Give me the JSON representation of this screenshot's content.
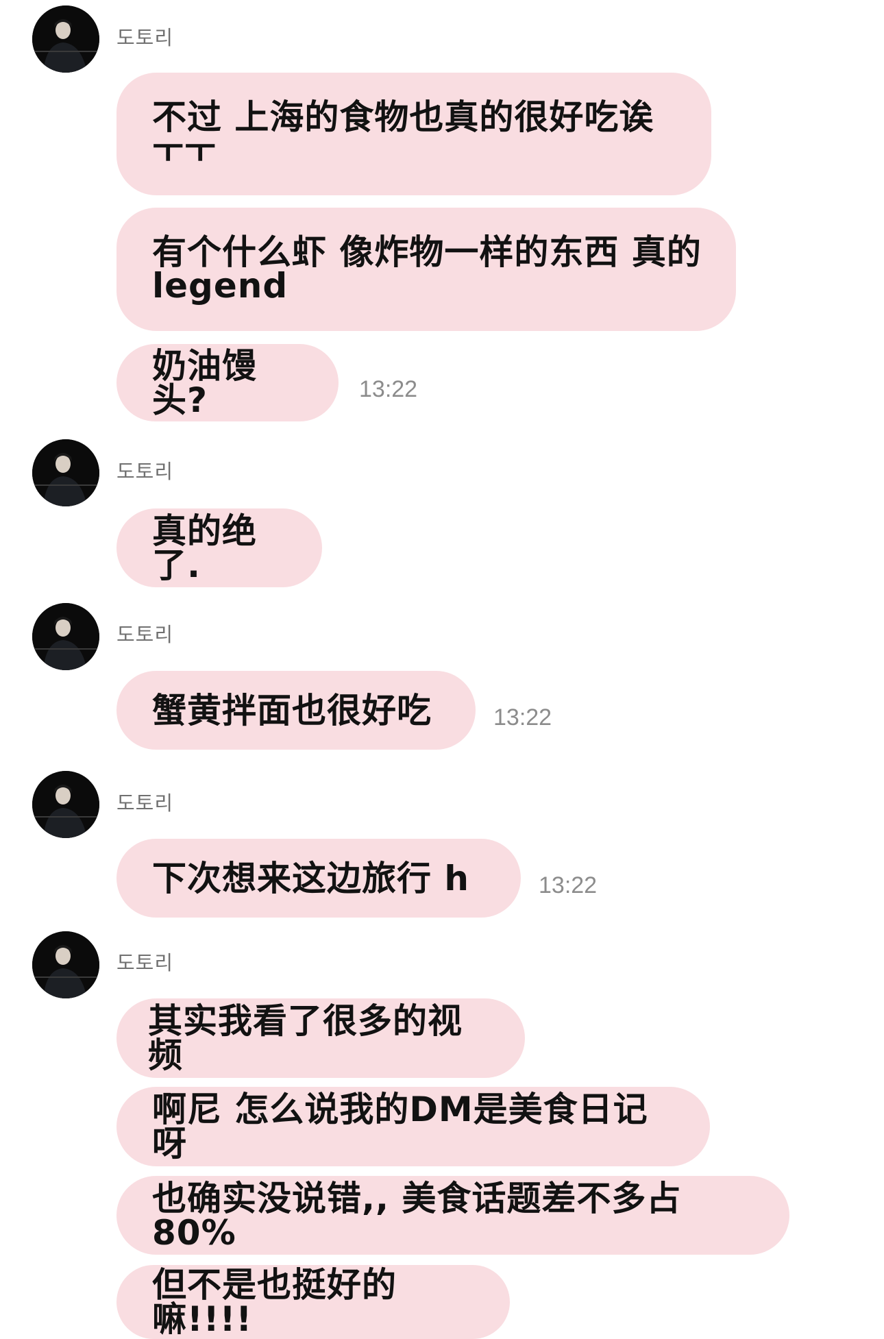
{
  "chat": {
    "messages": [
      {
        "sender": "도토리",
        "bubbles": [
          "不过 上海的食物也真的很好吃诶\nㅜㅜ",
          "有个什么虾 像炸物一样的东西 真的\nlegend",
          "奶油馒头?"
        ],
        "time": "13:22"
      },
      {
        "sender": "도토리",
        "bubbles": [
          "真的绝了."
        ],
        "time": ""
      },
      {
        "sender": "도토리",
        "bubbles": [
          "蟹黄拌面也很好吃"
        ],
        "time": "13:22"
      },
      {
        "sender": "도토리",
        "bubbles": [
          "下次想来这边旅行 h"
        ],
        "time": "13:22"
      },
      {
        "sender": "도토리",
        "bubbles": [
          "其实我看了很多的视频",
          "啊尼 怎么说我的DM是美食日记呀",
          "也确实没说错,, 美食话题差不多占80%",
          "但不是也挺好的嘛!!!!"
        ],
        "time": ""
      }
    ]
  },
  "colors": {
    "bubble_bg": "#f9dde1",
    "text": "#121212",
    "sender": "#707070",
    "time": "#8c8c8c",
    "avatar_bg": "#0a0a0a"
  },
  "icons": {
    "avatar": "profile-photo-avatar"
  }
}
